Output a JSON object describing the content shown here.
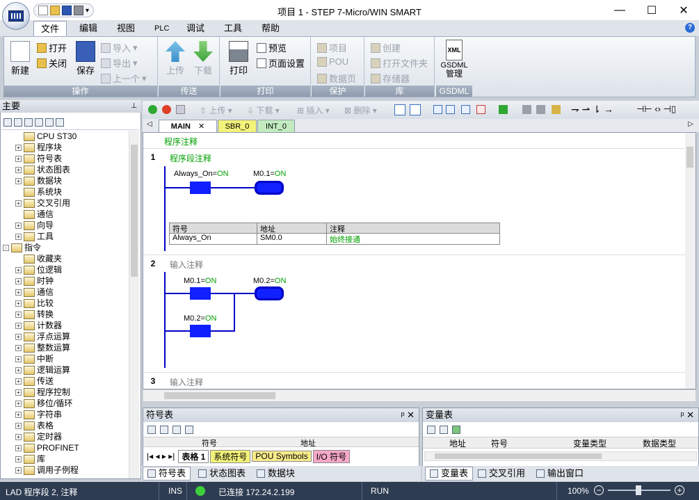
{
  "window": {
    "title": "项目 1 - STEP 7-Micro/WIN SMART",
    "min": "—",
    "max": "☐",
    "close": "✕"
  },
  "ribbon_tabs": [
    "文件",
    "编辑",
    "视图",
    "PLC",
    "调试",
    "工具",
    "帮助"
  ],
  "ribbon": {
    "g1": {
      "label": "操作",
      "new": "新建",
      "open": "打开",
      "close": "关闭",
      "save": "保存",
      "import": "导入",
      "export": "导出",
      "prev": "上一个"
    },
    "g2": {
      "label": "传送",
      "upload": "上传",
      "download": "下载"
    },
    "g3": {
      "label": "打印",
      "print": "打印",
      "preview": "预览",
      "page_setup": "页面设置"
    },
    "g4": {
      "label": "保护",
      "project": "项目",
      "pou": "POU",
      "datapage": "数据页"
    },
    "g5": {
      "label": "库",
      "create": "创建",
      "open_folder": "打开文件夹",
      "memory": "存储器"
    },
    "g6": {
      "label": "GSDML",
      "gsdml": "GSDML",
      "manage": "管理",
      "xml": "XML"
    }
  },
  "main_panel": {
    "title": "主要",
    "pin": "ᵖ"
  },
  "tree": [
    {
      "label": "CPU ST30",
      "exp": ""
    },
    {
      "label": "程序块",
      "exp": "+"
    },
    {
      "label": "符号表",
      "exp": "+"
    },
    {
      "label": "状态图表",
      "exp": "+"
    },
    {
      "label": "数据块",
      "exp": "+"
    },
    {
      "label": "系统块",
      "exp": ""
    },
    {
      "label": "交叉引用",
      "exp": "+"
    },
    {
      "label": "通信",
      "exp": ""
    },
    {
      "label": "向导",
      "exp": "+"
    },
    {
      "label": "工具",
      "exp": "+"
    },
    {
      "label": "指令",
      "exp": "-",
      "root": true
    },
    {
      "label": "收藏夹",
      "exp": ""
    },
    {
      "label": "位逻辑",
      "exp": "+"
    },
    {
      "label": "时钟",
      "exp": "+"
    },
    {
      "label": "通信",
      "exp": "+"
    },
    {
      "label": "比较",
      "exp": "+"
    },
    {
      "label": "转换",
      "exp": "+"
    },
    {
      "label": "计数器",
      "exp": "+"
    },
    {
      "label": "浮点运算",
      "exp": "+"
    },
    {
      "label": "整数运算",
      "exp": "+"
    },
    {
      "label": "中断",
      "exp": "+"
    },
    {
      "label": "逻辑运算",
      "exp": "+"
    },
    {
      "label": "传送",
      "exp": "+"
    },
    {
      "label": "程序控制",
      "exp": "+"
    },
    {
      "label": "移位/循环",
      "exp": "+"
    },
    {
      "label": "字符串",
      "exp": "+"
    },
    {
      "label": "表格",
      "exp": "+"
    },
    {
      "label": "定时器",
      "exp": "+"
    },
    {
      "label": "PROFINET",
      "exp": "+"
    },
    {
      "label": "库",
      "exp": "+"
    },
    {
      "label": "调用子例程",
      "exp": "+"
    }
  ],
  "editor_toolbar": {
    "upload": "上传",
    "download": "下载",
    "insert": "插入",
    "delete": "删除"
  },
  "editor_tabs": [
    "MAIN",
    "SBR_0",
    "INT_0"
  ],
  "program": {
    "comment": "程序注释",
    "n1": {
      "num": "1",
      "comment": "程序段注释",
      "contact": "Always_On",
      "coil": "M0.1",
      "state": "ON",
      "table": {
        "headers": [
          "符号",
          "地址",
          "注释"
        ],
        "row": [
          "Always_On",
          "SM0.0",
          "始终接通"
        ]
      }
    },
    "n2": {
      "num": "2",
      "comment": "输入注释",
      "c1": "M0.1",
      "c2": "M0.2",
      "coil": "M0.2",
      "state": "ON"
    },
    "n3": {
      "num": "3",
      "comment": "输入注释"
    }
  },
  "symbol_panel": {
    "title": "符号表",
    "col1": "符号",
    "col2": "地址",
    "tabs": [
      "表格 1",
      "系统符号",
      "POU Symbols",
      "I/O 符号"
    ]
  },
  "var_panel": {
    "title": "变量表",
    "cols": [
      "地址",
      "符号",
      "变量类型",
      "数据类型"
    ]
  },
  "bottom_tabs_left": [
    "符号表",
    "状态图表",
    "数据块"
  ],
  "bottom_tabs_right": [
    "变量表",
    "交叉引用",
    "输出窗口"
  ],
  "status": {
    "mode": "LAD 程序段 2, 注释",
    "ins": "INS",
    "conn": "已连接 172.24.2.199",
    "run": "RUN",
    "zoom": "100%"
  },
  "colors": {
    "accent": "#0000c8",
    "on": "#00a000",
    "status_bg": "#2e3c52"
  }
}
